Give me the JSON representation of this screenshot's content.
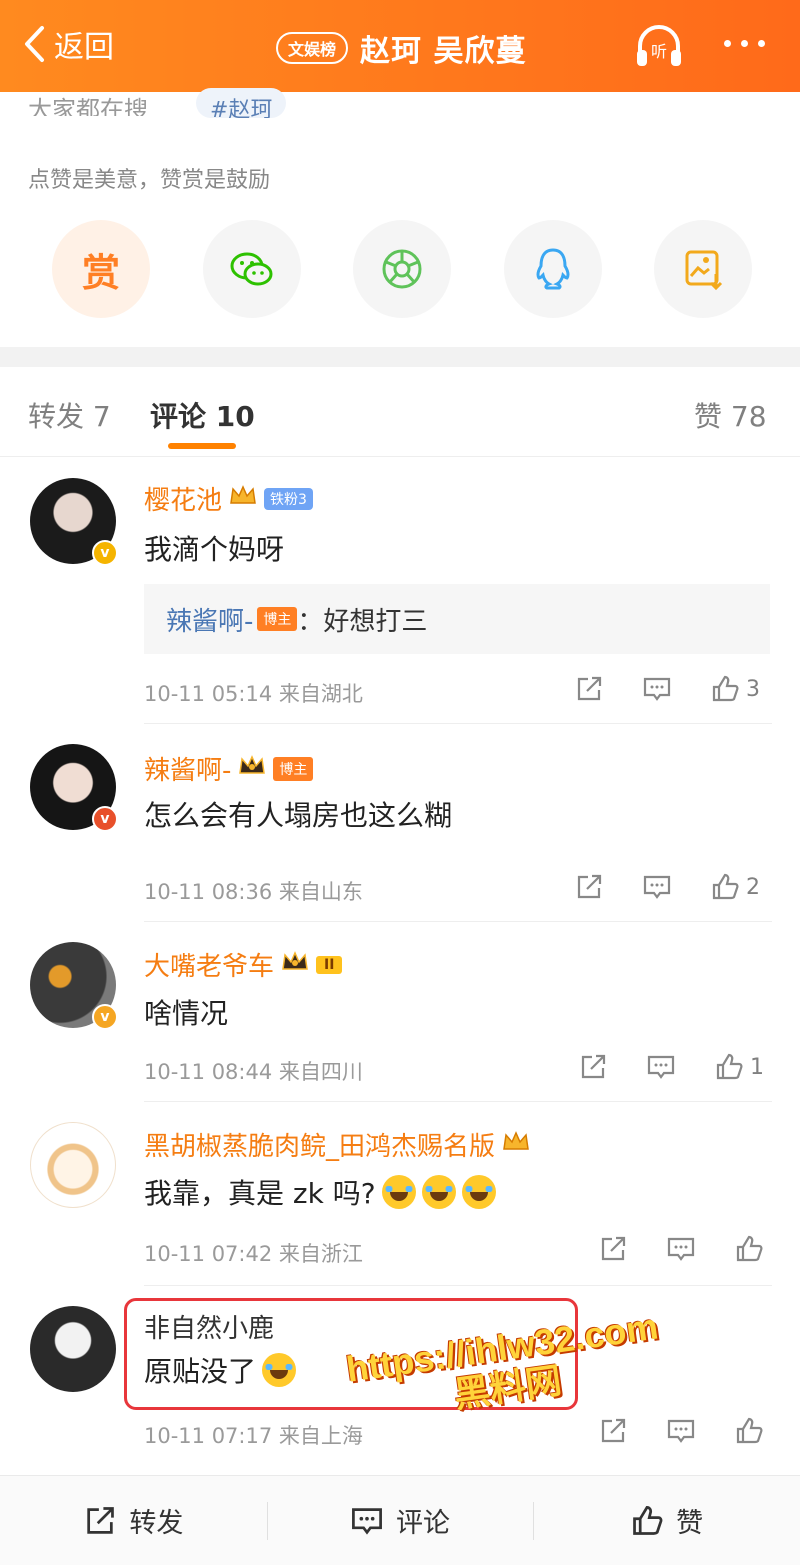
{
  "header": {
    "back_label": "返回",
    "badge": "文娱榜",
    "title": "赵珂 吴欣蔓"
  },
  "top_card": {
    "search_partial": "大家都在搜",
    "search_tag": "#赵珂",
    "reward_text": "点赞是美意，赞赏是鼓励",
    "reward_label": "赏"
  },
  "tabs": {
    "repost": "转发 7",
    "comments": "评论 10",
    "likes": "赞 78"
  },
  "comments": [
    {
      "username": "樱花池",
      "fan_badge": "铁粉3",
      "text": "我滴个妈呀",
      "reply_user": "辣酱啊-",
      "reply_badge": "博主",
      "reply_text": "：好想打三",
      "time": "10-11 05:14",
      "location": "来自湖北",
      "likes": "3"
    },
    {
      "username": "辣酱啊-",
      "host_badge": "博主",
      "text": "怎么会有人塌房也这么糊",
      "time": "10-11 08:36",
      "location": "来自山东",
      "likes": "2"
    },
    {
      "username": "大嘴老爷车",
      "level_badge": "II",
      "text": "啥情况",
      "time": "10-11 08:44",
      "location": "来自四川",
      "likes": "1"
    },
    {
      "username": "黑胡椒蒸脆肉鲩_田鸿杰赐名版",
      "text": "我靠，真是 zk 吗?",
      "time": "10-11 07:42",
      "location": "来自浙江",
      "likes": ""
    },
    {
      "username": "非自然小鹿",
      "text": "原贴没了",
      "time": "10-11 07:17",
      "location": "来自上海",
      "likes": ""
    }
  ],
  "watermark": {
    "line1": "https://ihlw32.com",
    "line2": "黑料网"
  },
  "bottom_bar": {
    "repost": "转发",
    "comment": "评论",
    "like": "赞"
  },
  "colors": {
    "header_orange": "#ff7a1c",
    "accent": "#ff8200",
    "username": "#f57d12",
    "reply_link": "#4a77b4",
    "highlight": "#e8363b"
  }
}
